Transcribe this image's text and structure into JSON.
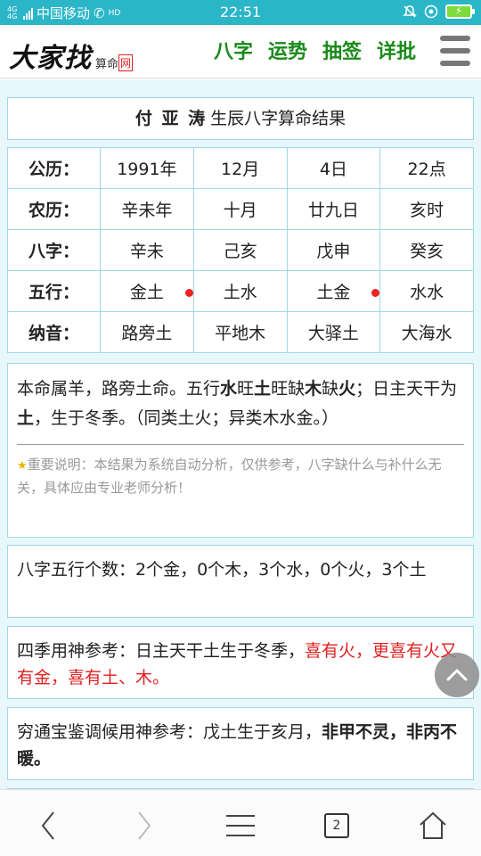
{
  "status": {
    "network": "4G 4G",
    "hd": "HD",
    "carrier": "中国移动",
    "time": "22:51",
    "battery": "⚡"
  },
  "header": {
    "logo_main": "大家找",
    "logo_sub": "算命",
    "logo_box": "网",
    "nav": [
      "八字",
      "运势",
      "抽签",
      "详批"
    ]
  },
  "result": {
    "name": "付 亚 涛",
    "title": "生辰八字算命结果"
  },
  "table": [
    {
      "label": "公历：",
      "cells": [
        "1991年",
        "12月",
        "4日",
        "22点"
      ]
    },
    {
      "label": "农历：",
      "cells": [
        "辛未年",
        "十月",
        "廿九日",
        "亥时"
      ]
    },
    {
      "label": "八字：",
      "cells": [
        "辛未",
        "己亥",
        "戊申",
        "癸亥"
      ]
    },
    {
      "label": "五行：",
      "cells": [
        "金土",
        "土水",
        "土金",
        "水水"
      ]
    },
    {
      "label": "纳音：",
      "cells": [
        "路旁土",
        "平地木",
        "大驿土",
        "大海水"
      ]
    }
  ],
  "summary": {
    "p1": "本命属羊，路旁土命。五行",
    "w1": "水",
    "p2": "旺",
    "w2": "土",
    "p3": "旺缺",
    "w3": "木",
    "p4": "缺",
    "w4": "火",
    "p5": "；日主天干为",
    "w5": "土",
    "p6": "，生于冬季。（同类土火；异类木水金。）",
    "note": "重要说明：本结果为系统自动分析，仅供参考，八字缺什么与补什么无关，具体应由专业老师分析！"
  },
  "count": "八字五行个数：2个金，0个木，3个水，0个火，3个土",
  "season": {
    "normal": "四季用神参考：日主天干土生于冬季，",
    "red": "喜有火，更喜有火又有金，喜有土、木。"
  },
  "qiong": {
    "normal": "穷通宝鉴调候用神参考：戊土生于亥月，",
    "bold": "非甲不灵，非丙不暖。"
  },
  "bottom": {
    "tab_count": "2"
  }
}
